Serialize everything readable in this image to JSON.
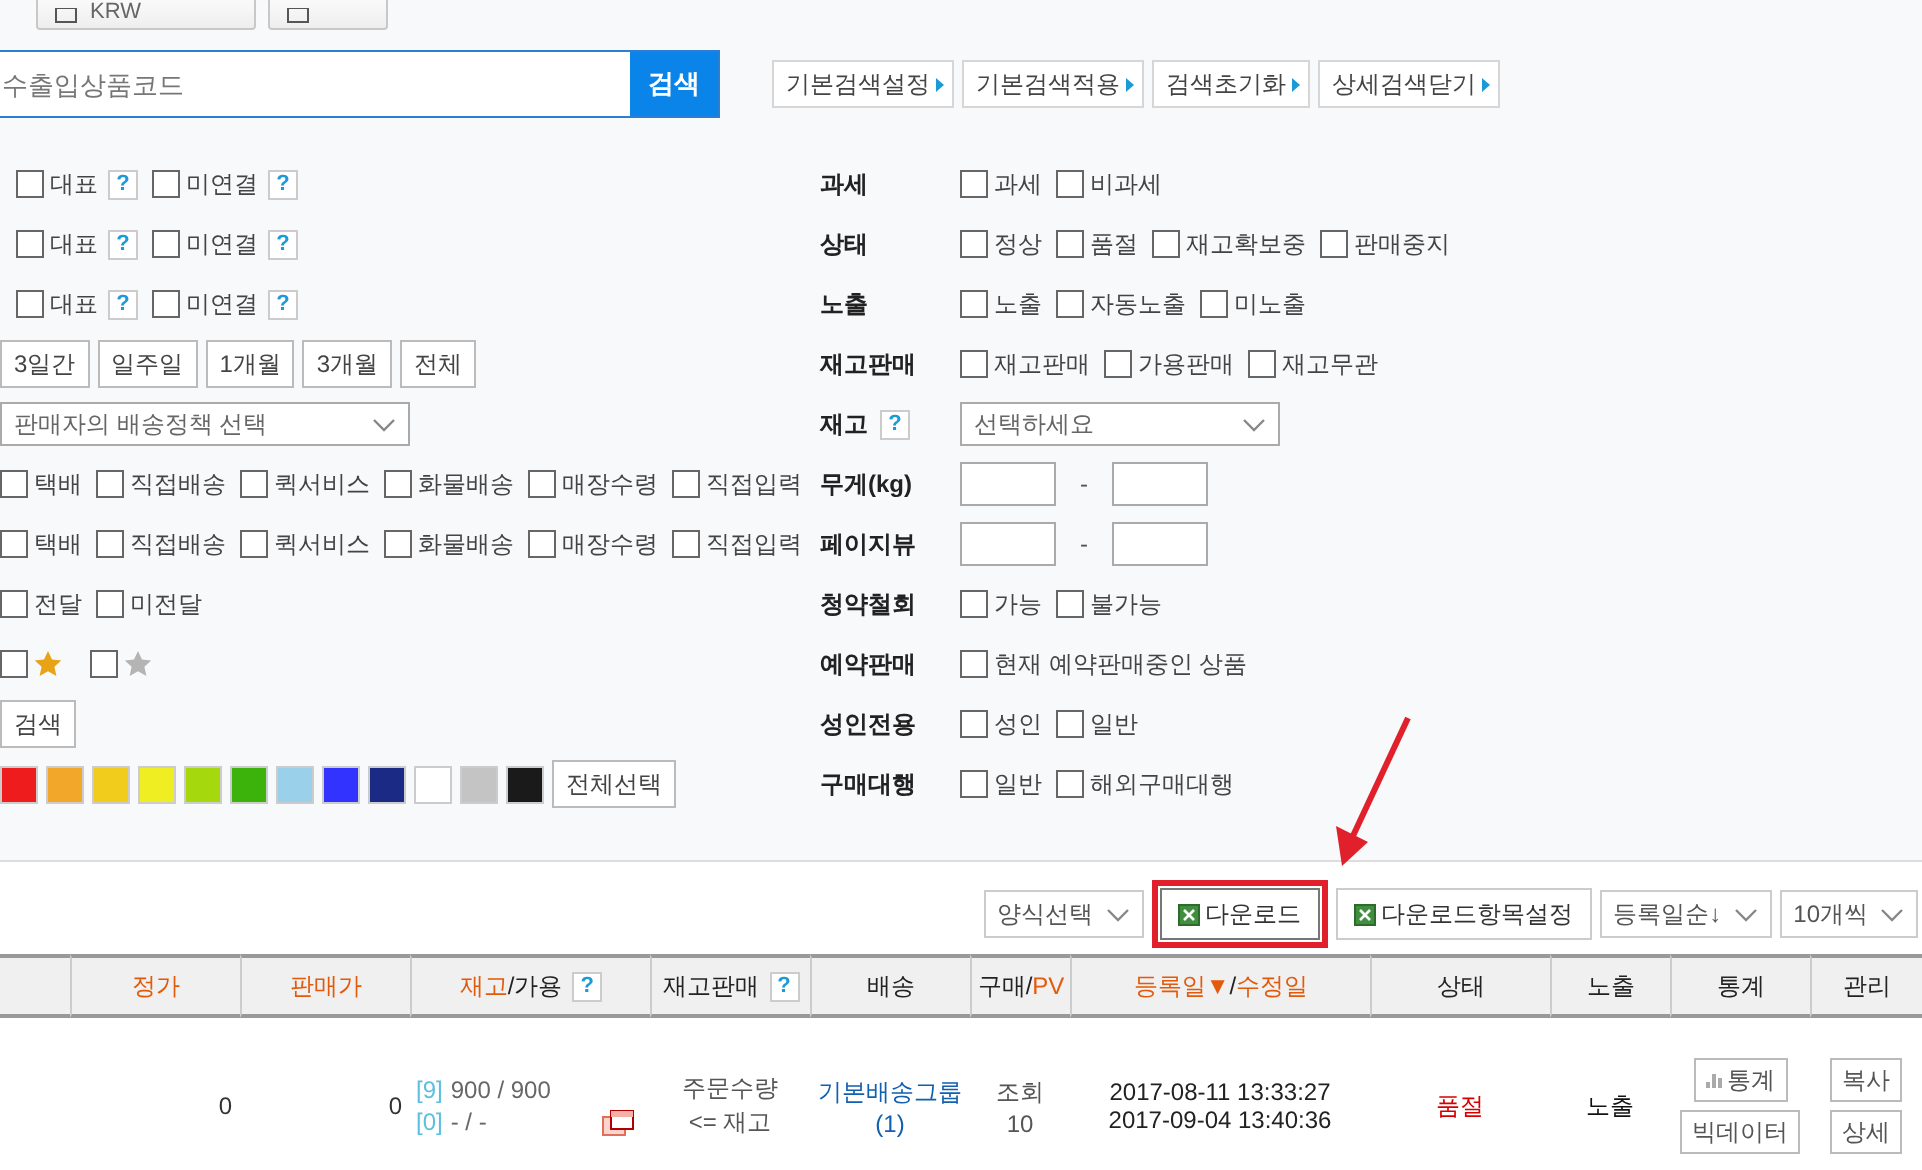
{
  "top_buttons": [
    {
      "kind": "currency",
      "label": "KRW"
    },
    {
      "kind": "file"
    }
  ],
  "search": {
    "placeholder": "수출입상품코드",
    "button": "검색"
  },
  "search_actions": [
    "기본검색설정",
    "기본검색적용",
    "검색초기화",
    "상세검색닫기"
  ],
  "left_rows": [
    {
      "kind": "checks",
      "items": [
        {
          "label": "대표",
          "checked": false,
          "help": "?"
        },
        {
          "label": "미연결",
          "checked": false,
          "help": "?"
        }
      ]
    },
    {
      "kind": "checks",
      "items": [
        {
          "label": "대표",
          "checked": false,
          "help": "?"
        },
        {
          "label": "미연결",
          "checked": false,
          "help": "?"
        }
      ]
    },
    {
      "kind": "checks",
      "items": [
        {
          "label": "대표",
          "checked": false,
          "help": "?"
        },
        {
          "label": "미연결",
          "checked": false,
          "help": "?"
        }
      ]
    },
    {
      "kind": "periods",
      "items": [
        "3일간",
        "일주일",
        "1개월",
        "3개월",
        "전체"
      ]
    },
    {
      "kind": "select",
      "value": "판매자의 배송정책 선택"
    },
    {
      "kind": "checks",
      "items": [
        {
          "label": "택배",
          "checked": false
        },
        {
          "label": "직접배송",
          "checked": false
        },
        {
          "label": "퀵서비스",
          "checked": false
        },
        {
          "label": "화물배송",
          "checked": false
        },
        {
          "label": "매장수령",
          "checked": false
        },
        {
          "label": "직접입력",
          "checked": false
        }
      ]
    },
    {
      "kind": "checks",
      "items": [
        {
          "label": "택배",
          "checked": false
        },
        {
          "label": "직접배송",
          "checked": false
        },
        {
          "label": "퀵서비스",
          "checked": false
        },
        {
          "label": "화물배송",
          "checked": false
        },
        {
          "label": "매장수령",
          "checked": false
        },
        {
          "label": "직접입력",
          "checked": false
        }
      ]
    },
    {
      "kind": "checks",
      "items": [
        {
          "label": "전달",
          "checked": false
        },
        {
          "label": "미전달",
          "checked": false
        }
      ]
    },
    {
      "kind": "stars",
      "items": [
        {
          "checked": false,
          "color": "#e8a317"
        },
        {
          "checked": false,
          "color": "#b4b4b4"
        }
      ]
    },
    {
      "kind": "button",
      "label": "검색"
    },
    {
      "kind": "colors",
      "items": [
        {
          "color": "#ee1c1c"
        },
        {
          "color": "#f2a62a"
        },
        {
          "color": "#f2cc1c"
        },
        {
          "color": "#eeee22"
        },
        {
          "color": "#a5d90e"
        },
        {
          "color": "#3cb30a"
        },
        {
          "color": "#9ad0ea"
        },
        {
          "color": "#3333ff"
        },
        {
          "color": "#1b2a85"
        },
        {
          "color": "#ffffff"
        },
        {
          "color": "#c4c4c4"
        },
        {
          "color": "#1a1a1a"
        }
      ],
      "button": "전체선택"
    }
  ],
  "right_rows": [
    {
      "label": "과세",
      "kind": "checks",
      "options": [
        {
          "label": "과세",
          "checked": false
        },
        {
          "label": "비과세",
          "checked": false
        }
      ]
    },
    {
      "label": "상태",
      "kind": "checks",
      "options": [
        {
          "label": "정상",
          "checked": false
        },
        {
          "label": "품절",
          "checked": false
        },
        {
          "label": "재고확보중",
          "checked": false
        },
        {
          "label": "판매중지",
          "checked": false
        }
      ]
    },
    {
      "label": "노출",
      "kind": "checks",
      "options": [
        {
          "label": "노출",
          "checked": false
        },
        {
          "label": "자동노출",
          "checked": false
        },
        {
          "label": "미노출",
          "checked": false
        }
      ]
    },
    {
      "label": "재고판매",
      "kind": "checks",
      "options": [
        {
          "label": "재고판매",
          "checked": false
        },
        {
          "label": "가용판매",
          "checked": false
        },
        {
          "label": "재고무관",
          "checked": false
        }
      ]
    },
    {
      "label": "재고",
      "help": "?",
      "kind": "select",
      "value": "선택하세요"
    },
    {
      "label": "무게(kg)",
      "kind": "range",
      "separator": "-"
    },
    {
      "label": "페이지뷰",
      "kind": "range",
      "separator": "-"
    },
    {
      "label": "청약철회",
      "kind": "checks",
      "options": [
        {
          "label": "가능",
          "checked": false
        },
        {
          "label": "불가능",
          "checked": false
        }
      ]
    },
    {
      "label": "예약판매",
      "kind": "checks",
      "options": [
        {
          "label": "현재 예약판매중인 상품",
          "checked": false
        }
      ]
    },
    {
      "label": "성인전용",
      "kind": "checks",
      "options": [
        {
          "label": "성인",
          "checked": false
        },
        {
          "label": "일반",
          "checked": false
        }
      ]
    },
    {
      "label": "구매대행",
      "kind": "checks",
      "options": [
        {
          "label": "일반",
          "checked": false
        },
        {
          "label": "해외구매대행",
          "checked": false
        }
      ]
    }
  ],
  "toolbar": [
    {
      "kind": "select",
      "label": "양식선택"
    },
    {
      "kind": "excel",
      "label": "다운로드",
      "highlighted": true
    },
    {
      "kind": "excel",
      "label": "다운로드항목설정",
      "highlighted": false
    },
    {
      "kind": "select",
      "label": "등록일순↓"
    },
    {
      "kind": "select",
      "label": "10개씩"
    }
  ],
  "table": {
    "columns": [
      {
        "parts": [
          {
            "text": "정가",
            "sortable": true
          }
        ]
      },
      {
        "parts": [
          {
            "text": "판매가",
            "sortable": true
          }
        ]
      },
      {
        "parts": [
          {
            "text": "재고",
            "sortable": true
          },
          {
            "text": "/가용",
            "sortable": false
          }
        ],
        "help": "?"
      },
      {
        "parts": [
          {
            "text": "재고판매",
            "sortable": false
          }
        ],
        "help": "?"
      },
      {
        "parts": [
          {
            "text": "배송",
            "sortable": false
          }
        ]
      },
      {
        "parts": [
          {
            "text": "구매/",
            "sortable": false
          },
          {
            "text": "PV",
            "sortable": true
          }
        ]
      },
      {
        "parts": [
          {
            "text": "등록일▼",
            "sortable": true
          },
          {
            "text": "/",
            "sortable": false
          },
          {
            "text": "수정일",
            "sortable": true
          }
        ]
      },
      {
        "parts": [
          {
            "text": "상태",
            "sortable": false
          }
        ]
      },
      {
        "parts": [
          {
            "text": "노출",
            "sortable": false
          }
        ]
      },
      {
        "parts": [
          {
            "text": "통계",
            "sortable": false
          }
        ]
      },
      {
        "parts": [
          {
            "text": "관리",
            "sortable": false
          }
        ]
      }
    ],
    "rows": [
      {
        "list_price": "0",
        "sale_price": "0",
        "stock": [
          {
            "tag": "[9]",
            "value": "900 / 900"
          },
          {
            "tag": "[0]",
            "value": "- / -"
          }
        ],
        "stock_sale": [
          "주문수량",
          "<= 재고"
        ],
        "shipping": [
          "기본배송그룹",
          "(1)"
        ],
        "views": [
          "조회",
          "10"
        ],
        "dates": [
          "2017-08-11 13:33:27",
          "2017-09-04 13:40:36"
        ],
        "status": "품절",
        "display": "노출",
        "stats_buttons": [
          "통계",
          "빅데이터"
        ],
        "manage_buttons": [
          "복사",
          "상세"
        ]
      }
    ]
  }
}
